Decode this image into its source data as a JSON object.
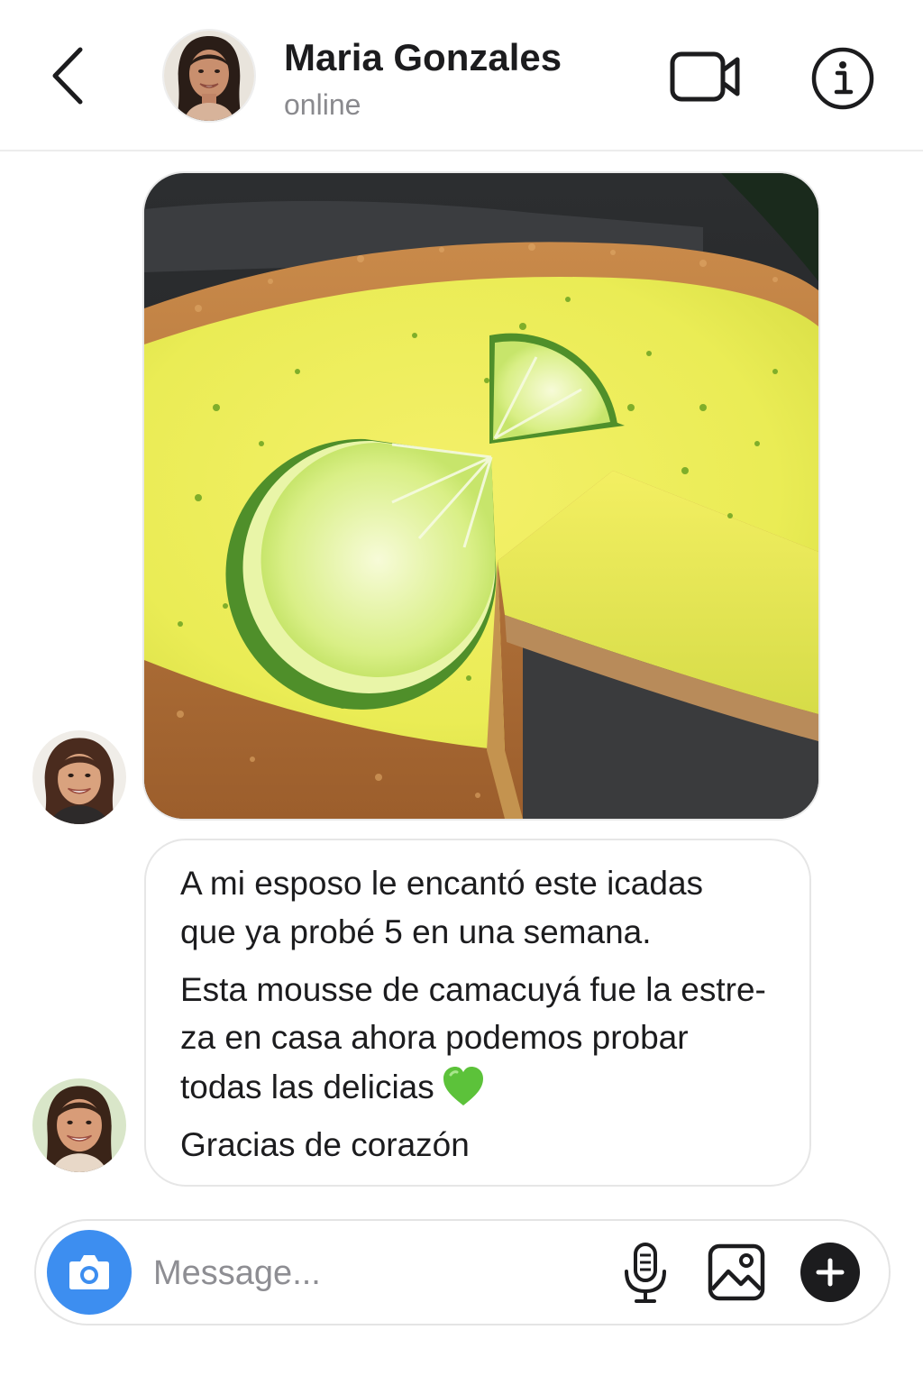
{
  "header": {
    "contact_name": "Maria Gonzales",
    "status": "online",
    "back_icon": "chevron-left-icon",
    "video_icon": "video-camera-icon",
    "info_icon": "info-circle-icon"
  },
  "conversation": {
    "photo_message": {
      "subject": "lime-tart-photo"
    },
    "text_message": {
      "lines": [
        "A mi esposo le encantó este icadas",
        "que ya probé 5 en una semana.",
        "Esta mousse de camacuyá fue la estre-",
        "za en casa ahora podemos probar",
        "todas las delicias",
        "Gracias de corazón"
      ],
      "emoji": "green-heart"
    }
  },
  "composer": {
    "placeholder": "Message...",
    "value": "",
    "camera_icon": "camera-icon",
    "mic_icon": "microphone-icon",
    "gallery_icon": "image-icon",
    "plus_icon": "plus-icon"
  },
  "colors": {
    "accent": "#3d8ef0",
    "heart": "#5cc23a",
    "text": "#1c1c1e",
    "muted": "#8a8a8e"
  }
}
